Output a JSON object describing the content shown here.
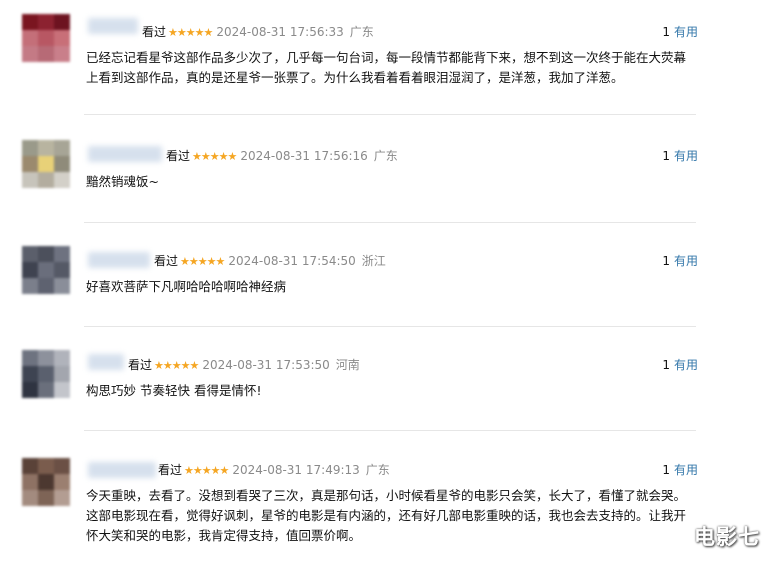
{
  "comments": [
    {
      "status": "看过",
      "stars": "★★★★★",
      "time": "2024-08-31 17:56:33",
      "location": "广东",
      "useful_count": "1",
      "useful_label": "有用",
      "text": "已经忘记看星爷这部作品多少次了，几乎每一句台词，每一段情节都能背下来，想不到这一次终于能在大荧幕上看到这部作品，真的是还星爷一张票了。为什么我看着看着眼泪湿润了，是洋葱，我加了洋葱。"
    },
    {
      "status": "看过",
      "stars": "★★★★★",
      "time": "2024-08-31 17:56:16",
      "location": "广东",
      "useful_count": "1",
      "useful_label": "有用",
      "text": "黯然销魂饭~"
    },
    {
      "status": "看过",
      "stars": "★★★★★",
      "time": "2024-08-31 17:54:50",
      "location": "浙江",
      "useful_count": "1",
      "useful_label": "有用",
      "text": "好喜欢菩萨下凡啊哈哈哈啊哈神经病"
    },
    {
      "status": "看过",
      "stars": "★★★★★",
      "time": "2024-08-31 17:53:50",
      "location": "河南",
      "useful_count": "1",
      "useful_label": "有用",
      "text": "构思巧妙 节奏轻快 看得是情怀!"
    },
    {
      "status": "看过",
      "stars": "★★★★★",
      "time": "2024-08-31 17:49:13",
      "location": "广东",
      "useful_count": "1",
      "useful_label": "有用",
      "text": "今天重映，去看了。没想到看哭了三次，真是那句话，小时候看星爷的电影只会笑，长大了，看懂了就会哭。这部电影现在看，觉得好讽刺，星爷的电影是有内涵的，还有好几部电影重映的话，我也会去支持的。让我开怀大笑和哭的电影，我肯定得支持，值回票价啊。"
    }
  ],
  "watermark": "电影七"
}
